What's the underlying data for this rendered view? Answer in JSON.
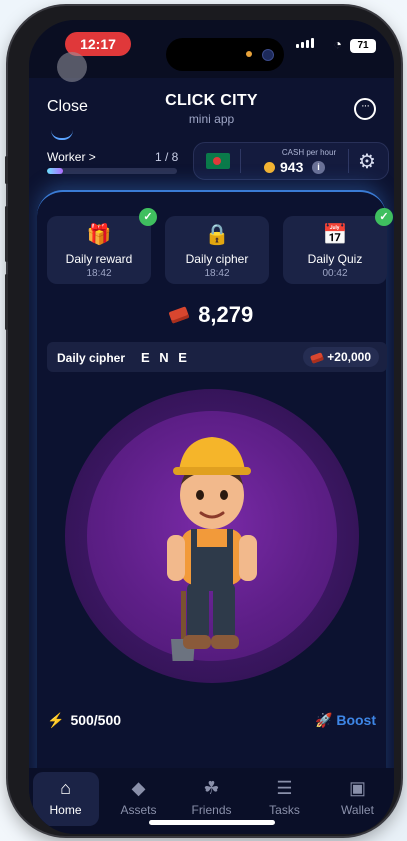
{
  "status_bar": {
    "time": "12:17",
    "battery": "71"
  },
  "header": {
    "close_label": "Close",
    "title": "CLICK CITY",
    "subtitle": "mini app"
  },
  "worker": {
    "label": "Worker >",
    "count": "1 / 8",
    "progress": 0.125
  },
  "cash": {
    "label": "CASH per hour",
    "value": "943"
  },
  "cards": [
    {
      "title": "Daily reward",
      "time": "18:42",
      "icon": "gift-icon",
      "checked": true
    },
    {
      "title": "Daily cipher",
      "time": "18:42",
      "icon": "lock-icon",
      "checked": false
    },
    {
      "title": "Daily Quiz",
      "time": "00:42",
      "icon": "calendar-icon",
      "checked": true
    }
  ],
  "balance": "8,279",
  "cipher": {
    "label": "Daily cipher",
    "word": "E N E",
    "reward": "+20,000"
  },
  "energy": {
    "value": "500/500"
  },
  "boost": {
    "label": "Boost"
  },
  "nav": [
    {
      "label": "Home",
      "icon": "home-icon",
      "active": true
    },
    {
      "label": "Assets",
      "icon": "assets-icon",
      "active": false
    },
    {
      "label": "Friends",
      "icon": "friends-icon",
      "active": false
    },
    {
      "label": "Tasks",
      "icon": "tasks-icon",
      "active": false
    },
    {
      "label": "Wallet",
      "icon": "wallet-icon",
      "active": false
    }
  ],
  "colors": {
    "accent": "#3e86e6",
    "background": "#0d1330",
    "circle": "#5e1f88"
  }
}
